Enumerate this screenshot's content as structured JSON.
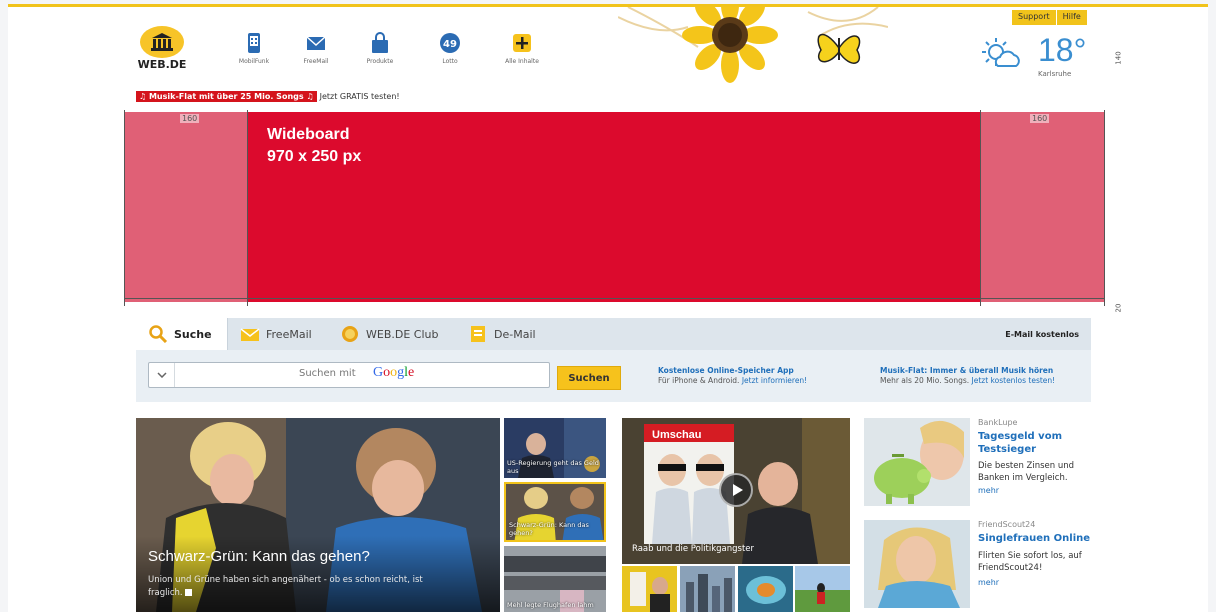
{
  "header": {
    "logo_text": "WEB.DE",
    "nav": [
      {
        "label": "MobilFunk",
        "icon": "phone-icon"
      },
      {
        "label": "FreeMail",
        "icon": "mail-icon"
      },
      {
        "label": "Produkte",
        "icon": "bag-icon"
      },
      {
        "label": "Lotto",
        "icon": "lotto-ball-icon",
        "badge": "49"
      },
      {
        "label": "Alle Inhalte",
        "icon": "plus-icon"
      }
    ],
    "support": "Support",
    "hilfe": "Hilfe",
    "temperature": "18°",
    "city": "Karlsruhe",
    "side_number_top": "140",
    "side_number_bottom": "20",
    "promo_badge": "♫ Musik-Flat mit über 25 Mio. Songs ♫",
    "promo_text": "Jetzt GRATIS testen!"
  },
  "ad": {
    "wideboard_line1": "Wideboard",
    "wideboard_line2": "970 x 250 px",
    "left_width": "160",
    "right_width": "160",
    "colors": {
      "skyscraper": "#e06076",
      "wideboard": "#dc0a2d"
    }
  },
  "tabs": [
    {
      "label": "Suche",
      "icon": "search-icon",
      "active": true
    },
    {
      "label": "FreeMail",
      "icon": "mail-icon",
      "active": false
    },
    {
      "label": "WEB.DE Club",
      "icon": "club-badge-icon",
      "active": false
    },
    {
      "label": "De-Mail",
      "icon": "demail-icon",
      "active": false
    }
  ],
  "email_kostenlos": "E-Mail kostenlos",
  "search": {
    "hint": "Suchen mit",
    "google": "Google",
    "button": "Suchen",
    "promo1_title": "Kostenlose Online-Speicher App",
    "promo1_sub": "Für iPhone & Android.",
    "promo1_link": "Jetzt informieren!",
    "promo2_title": "Musik-Flat: Immer & überall Musik hören",
    "promo2_sub": "Mehr als 20 Mio. Songs.",
    "promo2_link": "Jetzt kostenlos testen!"
  },
  "hero": {
    "title": "Schwarz-Grün: Kann das gehen?",
    "subtitle": "Union und Grüne haben sich angenähert - ob es schon reicht, ist fraglich."
  },
  "thumbs": [
    {
      "caption": "US-Regierung geht das Geld aus"
    },
    {
      "caption": "Schwarz-Grün: Kann das gehen?"
    },
    {
      "caption": "Mehl legte Flughafen lahm"
    }
  ],
  "video": {
    "caption": "Raab und die Politikgangster",
    "sign": "Umschau"
  },
  "cards": [
    {
      "source": "BankLupe",
      "title": "Tagesgeld vom Testsieger",
      "desc": "Die besten Zinsen und Banken im Vergleich.",
      "more": "mehr"
    },
    {
      "source": "FriendScout24",
      "title": "Singlefrauen Online",
      "desc": "Flirten Sie sofort los, auf FriendScout24!",
      "more": "mehr"
    }
  ]
}
